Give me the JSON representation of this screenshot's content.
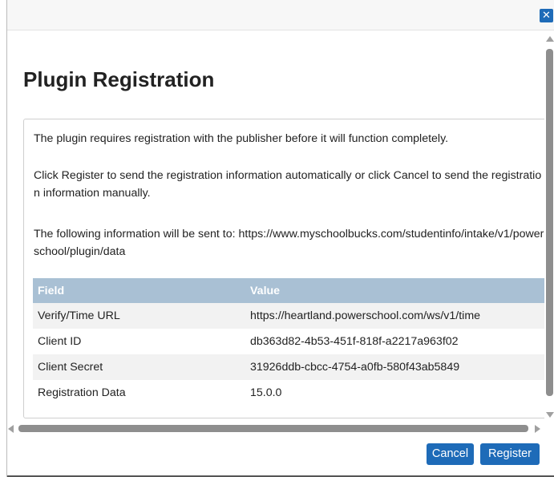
{
  "dialog": {
    "close_symbol": "✕",
    "title": "Plugin Registration",
    "intro_text": "The plugin requires registration with the publisher before it will function completely.",
    "instructions_text": "Click Register to send the registration information automatically or click Cancel to send the registration information manually.",
    "destination_text": "The following information will be sent to: https://www.myschoolbucks.com/studentinfo/intake/v1/powerschool/plugin/data",
    "table": {
      "headers": [
        "Field",
        "Value"
      ],
      "rows": [
        {
          "field": "Verify/Time URL",
          "value": "https://heartland.powerschool.com/ws/v1/time"
        },
        {
          "field": "Client ID",
          "value": "db363d82-4b53-451f-818f-a2217a963f02"
        },
        {
          "field": "Client Secret",
          "value": "31926ddb-cbcc-4754-a0fb-580f43ab5849"
        },
        {
          "field": "Registration Data",
          "value": "15.0.0"
        }
      ]
    },
    "buttons": {
      "cancel": "Cancel",
      "register": "Register"
    }
  },
  "colors": {
    "accent": "#1e6bb8",
    "table_header": "#a9c0d4",
    "row_stripe": "#f2f2f2"
  },
  "icons": {
    "close": "close-icon"
  }
}
